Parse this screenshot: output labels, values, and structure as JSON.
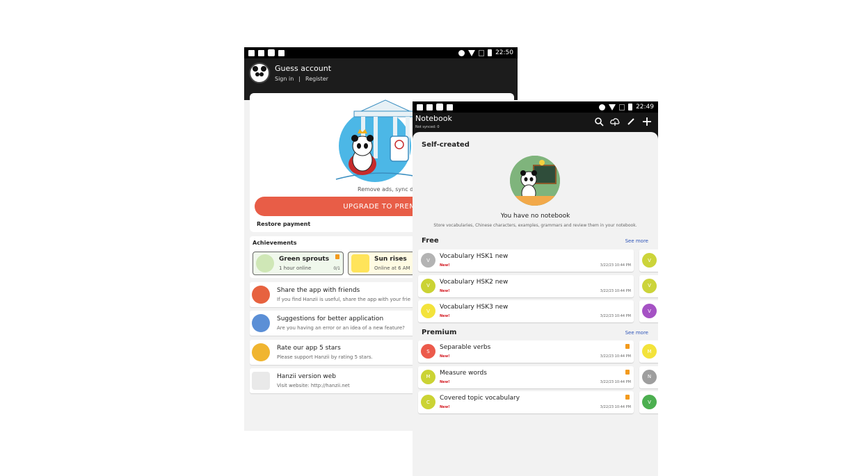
{
  "left_phone": {
    "status": {
      "time": "22:50"
    },
    "account": {
      "name": "Guess account",
      "sign_in": "Sign in",
      "separator": "|",
      "register": "Register"
    },
    "promo": {
      "text": "Remove ads, sync data",
      "upgrade_label": "UPGRADE TO PREMIU",
      "restore_label": "Restore payment"
    },
    "achievements": {
      "title": "Achievements",
      "items": [
        {
          "name": "Green sprouts",
          "sub": "1 hour online",
          "count": "0/1",
          "locked": true
        },
        {
          "name": "Sun rises",
          "sub": "Online at 6 AM"
        }
      ]
    },
    "menu": [
      {
        "title": "Share the app with friends",
        "sub": "If you find Hanzii is useful, share the app with your frie",
        "icon": "share-icon"
      },
      {
        "title": "Suggestions for better application",
        "sub": "Are you having an error or an idea of a new feature?",
        "icon": "suggestion-icon"
      },
      {
        "title": "Rate our app 5 stars",
        "sub": "Please support Hanzii by rating 5 stars.",
        "icon": "rate-icon"
      },
      {
        "title": "Hanzii version web",
        "sub": "Visit website: http://hanzii.net",
        "icon": "web-icon"
      }
    ]
  },
  "right_phone": {
    "status": {
      "time": "22:49"
    },
    "header": {
      "title": "Notebook",
      "subtitle": "Not synced: 0",
      "actions": [
        "search-icon",
        "cloud-sync-icon",
        "edit-icon",
        "add-icon"
      ]
    },
    "self_created": {
      "title": "Self-created",
      "empty_title": "You have no notebook",
      "empty_sub": "Store vocabularies, Chinese characters, examples, grammars and review them in your notebook."
    },
    "free": {
      "title": "Free",
      "see_more": "See more",
      "items": [
        {
          "badge": "V",
          "color": "#b3b3b3",
          "name": "Vocabulary HSK1 new",
          "tag": "New!",
          "date": "3/22/23 10:44 PM",
          "peek_badge": "V",
          "peek_color": "#ccd43a"
        },
        {
          "badge": "V",
          "color": "#cbd334",
          "name": "Vocabulary HSK2 new",
          "tag": "New!",
          "date": "3/22/23 10:44 PM",
          "peek_badge": "V",
          "peek_color": "#ccd43a"
        },
        {
          "badge": "V",
          "color": "#f3e33b",
          "name": "Vocabulary HSK3 new",
          "tag": "New!",
          "date": "3/22/23 10:44 PM",
          "peek_badge": "V",
          "peek_color": "#a552c4"
        }
      ]
    },
    "premium": {
      "title": "Premium",
      "see_more": "See more",
      "items": [
        {
          "badge": "S",
          "color": "#ec5a4b",
          "name": "Separable verbs",
          "tag": "New!",
          "date": "3/22/23 10:44 PM",
          "locked": true,
          "peek_badge": "M",
          "peek_color": "#f3e33b"
        },
        {
          "badge": "M",
          "color": "#cbd334",
          "name": "Measure words",
          "tag": "New!",
          "date": "3/22/23 10:44 PM",
          "locked": true,
          "peek_badge": "N",
          "peek_color": "#9e9e9e"
        },
        {
          "badge": "C",
          "color": "#cbd334",
          "name": "Covered topic vocabulary",
          "tag": "New!",
          "date": "3/22/23 10:44 PM",
          "locked": true,
          "peek_badge": "V",
          "peek_color": "#4caf50"
        }
      ]
    }
  }
}
